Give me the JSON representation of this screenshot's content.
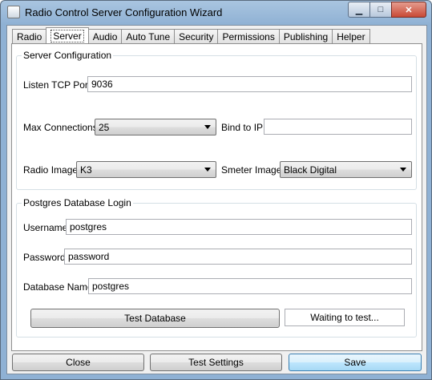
{
  "window": {
    "title": "Radio Control Server Configuration Wizard",
    "min_glyph": "▁",
    "max_glyph": "□",
    "close_glyph": "✕"
  },
  "tabs": [
    {
      "label": "Radio"
    },
    {
      "label": "Server",
      "active": true
    },
    {
      "label": "Audio"
    },
    {
      "label": "Auto Tune"
    },
    {
      "label": "Security"
    },
    {
      "label": "Permissions"
    },
    {
      "label": "Publishing"
    },
    {
      "label": "Helper"
    }
  ],
  "server_config": {
    "title": "Server Configuration",
    "listen_port_label": "Listen TCP Port",
    "listen_port_value": "9036",
    "max_connections_label": "Max Connections",
    "max_connections_value": "25",
    "bind_ip_label": "Bind to IP",
    "bind_ip_value": "",
    "radio_image_label": "Radio Image",
    "radio_image_value": "K3",
    "smeter_image_label": "Smeter Image",
    "smeter_image_value": "Black Digital"
  },
  "db_login": {
    "title": "Postgres Database Login",
    "username_label": "Username",
    "username_value": "postgres",
    "password_label": "Password",
    "password_value": "password",
    "dbname_label": "Database Name",
    "dbname_value": "postgres",
    "test_button": "Test Database",
    "status_text": "Waiting to test..."
  },
  "footer": {
    "close": "Close",
    "test_settings": "Test Settings",
    "save": "Save"
  }
}
